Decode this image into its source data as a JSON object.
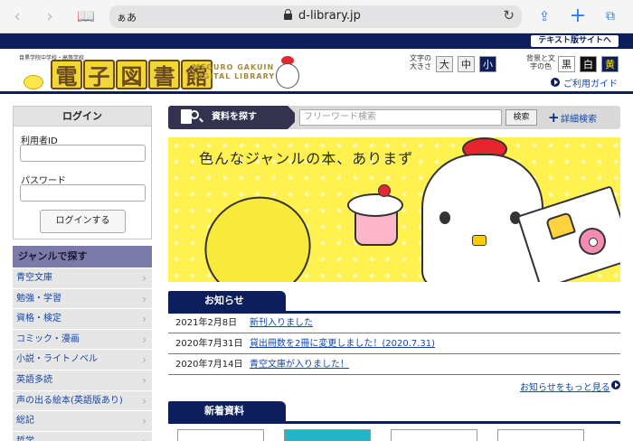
{
  "browser": {
    "aa_label": "ぁあ",
    "url": "d-library.jp",
    "icons": [
      "back-icon",
      "forward-icon",
      "bookmarks-icon",
      "reload-icon",
      "share-icon",
      "new-tab-icon",
      "tabs-icon"
    ]
  },
  "top_strip": {
    "text_version_link": "テキスト版サイトへ"
  },
  "header": {
    "school_name": "目黒学院中学校・高等学校",
    "logo_kanji": [
      "電",
      "子",
      "図",
      "書",
      "館"
    ],
    "logo_en_line1": "MEGURO GAKUIN",
    "logo_en_line2": "DIGITAL LIBRARY",
    "font_size_label": "文字の大きさ",
    "font_sizes": [
      "大",
      "中",
      "小"
    ],
    "color_label": "背景と文字の色",
    "colors": [
      "黒",
      "白",
      "黄"
    ],
    "guide_link": "ご利用ガイド"
  },
  "login": {
    "title": "ログイン",
    "user_id_label": "利用者ID",
    "password_label": "パスワード",
    "submit": "ログインする"
  },
  "genre": {
    "title": "ジャンルで探す",
    "items": [
      "青空文庫",
      "勉強・学習",
      "資格・検定",
      "コミック・漫画",
      "小説・ライトノベル",
      "英語多読",
      "声の出る絵本(英語版あり)",
      "総記",
      "哲学"
    ]
  },
  "search": {
    "title": "資料を探す",
    "placeholder": "フリーワード検索",
    "button": "検索",
    "advanced": "詳細検索"
  },
  "banner": {
    "caption": "色んなジャンルの本、ありまず"
  },
  "news": {
    "title": "お知らせ",
    "items": [
      {
        "date": "2021年2月8日",
        "text": "新刊入りました"
      },
      {
        "date": "2020年7月31日",
        "text": "貸出冊数を2冊に変更しました！(2020.7.31)"
      },
      {
        "date": "2020年7月14日",
        "text": "青空文庫が入りました！"
      }
    ],
    "more": "お知らせをもっと見る"
  },
  "new_items": {
    "title": "新着資料"
  },
  "colors": {
    "navy": "#0c1f5c",
    "banner_yellow": "#fff250",
    "link_blue": "#1547a8",
    "genre_header": "#7c7aa8"
  }
}
